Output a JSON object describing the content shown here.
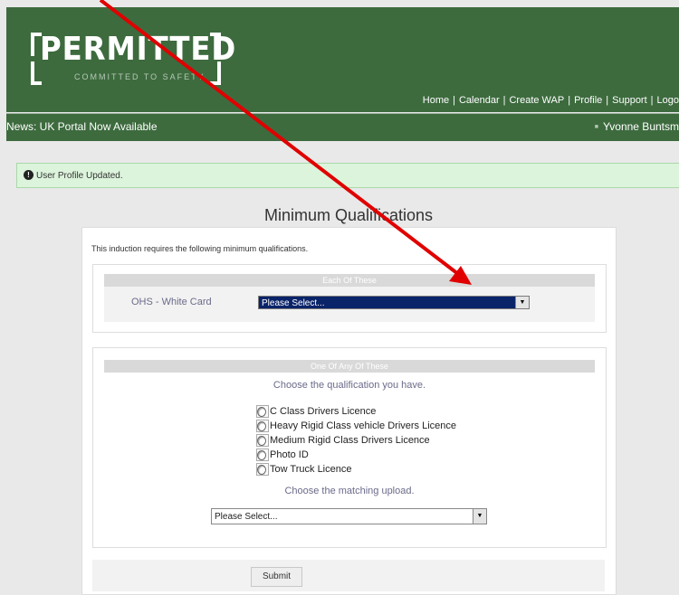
{
  "header": {
    "logo": {
      "main": "PERMITTED",
      "sub": "COMMITTED TO SAFETY"
    },
    "nav": [
      "Home",
      "Calendar",
      "Create WAP",
      "Profile",
      "Support",
      "Logo"
    ]
  },
  "newsbar": {
    "news": "News: UK Portal Now Available",
    "user": "Yvonne Buntsm"
  },
  "alert": {
    "text": "User Profile Updated."
  },
  "page": {
    "title": "Minimum Qualifications",
    "intro": "This induction requires the following minimum qualifications.",
    "each_section": {
      "header": "Each Of These",
      "qualification_label": "OHS - White Card",
      "select_value": "Please Select..."
    },
    "any_section": {
      "header": "One Of Any Of These",
      "choose_text": "Choose the qualification you have.",
      "options": [
        "C Class Drivers Licence",
        "Heavy Rigid Class vehicle Drivers Licence",
        "Medium Rigid Class Drivers Licence",
        "Photo ID",
        "Tow Truck Licence"
      ],
      "upload_text": "Choose the matching upload.",
      "upload_select_value": "Please Select..."
    },
    "submit_label": "Submit"
  },
  "colors": {
    "header_green": "#3d6b3e",
    "alert_bg": "#dcf4dc",
    "select_highlight": "#0a246a",
    "annotation_arrow": "#e00000"
  }
}
